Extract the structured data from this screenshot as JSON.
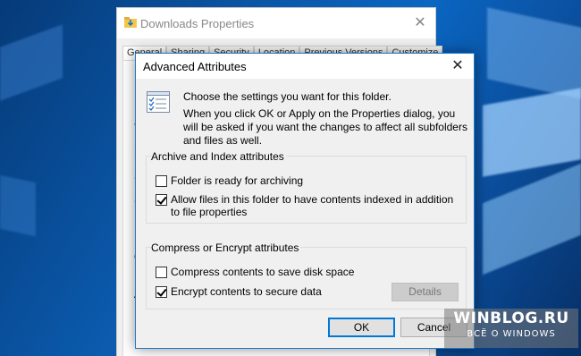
{
  "back_window": {
    "title": "Downloads Properties",
    "tabs": [
      "General",
      "Sharing",
      "Security",
      "Location",
      "Previous Versions",
      "Customize"
    ],
    "peek_letters": [
      "T",
      "L",
      "S",
      "S",
      "C",
      "A"
    ]
  },
  "dialog": {
    "title": "Advanced Attributes",
    "intro_line1": "Choose the settings you want for this folder.",
    "intro_line2": "When you click OK or Apply on the Properties dialog, you will be asked if you want the changes to affect all subfolders and files as well.",
    "archive_group": {
      "label": "Archive and Index attributes",
      "archive_label": "Folder is ready for archiving",
      "archive_checked": false,
      "index_label": "Allow files in this folder to have contents indexed in addition to file properties",
      "index_checked": true
    },
    "compress_group": {
      "label": "Compress or Encrypt attributes",
      "compress_label": "Compress contents to save disk space",
      "compress_checked": false,
      "encrypt_label": "Encrypt contents to secure data",
      "encrypt_checked": true,
      "details_label": "Details"
    },
    "ok_label": "OK",
    "cancel_label": "Cancel"
  },
  "watermark": {
    "line1": "WINBLOG.RU",
    "line2": "ВСЁ О WINDOWS"
  },
  "colors": {
    "accent": "#0078d7",
    "dialog_bg": "#f0f0f0",
    "desktop": "#0a5cb0"
  }
}
